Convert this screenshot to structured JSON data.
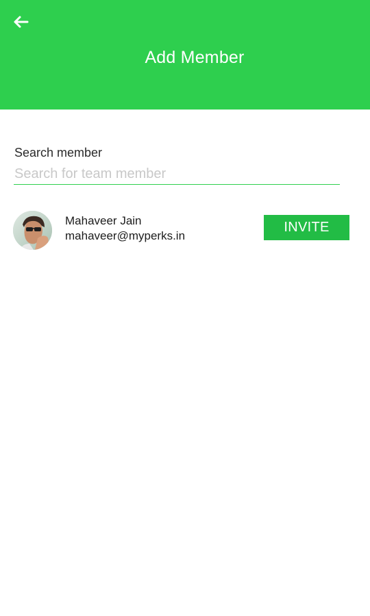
{
  "colors": {
    "header_bg": "#2ecf4e",
    "accent": "#22bc45",
    "text": "#1c1c1c",
    "placeholder": "#c8c8c8"
  },
  "header": {
    "back_icon": "arrow-left-icon",
    "title": "Add Member"
  },
  "search": {
    "label": "Search member",
    "placeholder": "Search for team member",
    "value": ""
  },
  "members": [
    {
      "name": "Mahaveer Jain",
      "email": "mahaveer@myperks.in",
      "avatar_icon": "user-avatar-photo",
      "action_label": "INVITE"
    }
  ]
}
